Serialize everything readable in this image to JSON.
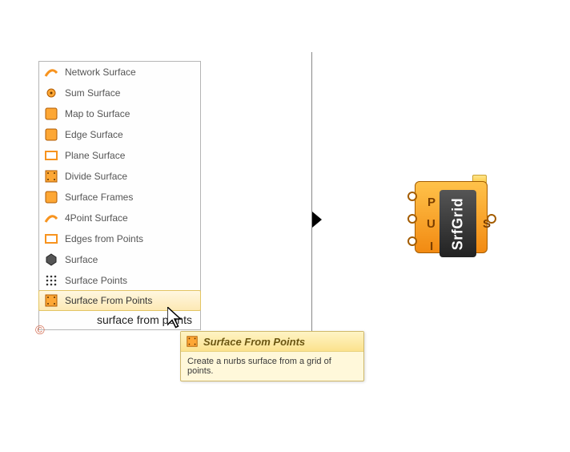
{
  "menu": {
    "items": [
      {
        "label": "Network Surface",
        "icon": "network-surface-icon"
      },
      {
        "label": "Sum Surface",
        "icon": "sum-surface-icon"
      },
      {
        "label": "Map to Surface",
        "icon": "map-to-surface-icon"
      },
      {
        "label": "Edge Surface",
        "icon": "edge-surface-icon"
      },
      {
        "label": "Plane Surface",
        "icon": "plane-surface-icon"
      },
      {
        "label": "Divide Surface",
        "icon": "divide-surface-icon"
      },
      {
        "label": "Surface Frames",
        "icon": "surface-frames-icon"
      },
      {
        "label": "4Point Surface",
        "icon": "four-point-surface-icon"
      },
      {
        "label": "Edges from Points",
        "icon": "edges-from-points-icon"
      },
      {
        "label": "Surface",
        "icon": "surface-icon"
      },
      {
        "label": "Surface Points",
        "icon": "surface-points-icon"
      },
      {
        "label": "Surface From Points",
        "icon": "surface-from-points-icon"
      }
    ],
    "highlighted_index": 11,
    "search_value": "surface from points"
  },
  "tooltip": {
    "title": "Surface From Points",
    "body": "Create a nurbs surface from a grid of points."
  },
  "component": {
    "name": "SrfGrid",
    "inputs": [
      "P",
      "U",
      "I"
    ],
    "outputs": [
      "S"
    ]
  },
  "colors": {
    "accent_orange": "#f7931e",
    "tooltip_bg": "#fff8da",
    "highlight_bg": "#fde9b5"
  },
  "copyright_glyph": "©"
}
